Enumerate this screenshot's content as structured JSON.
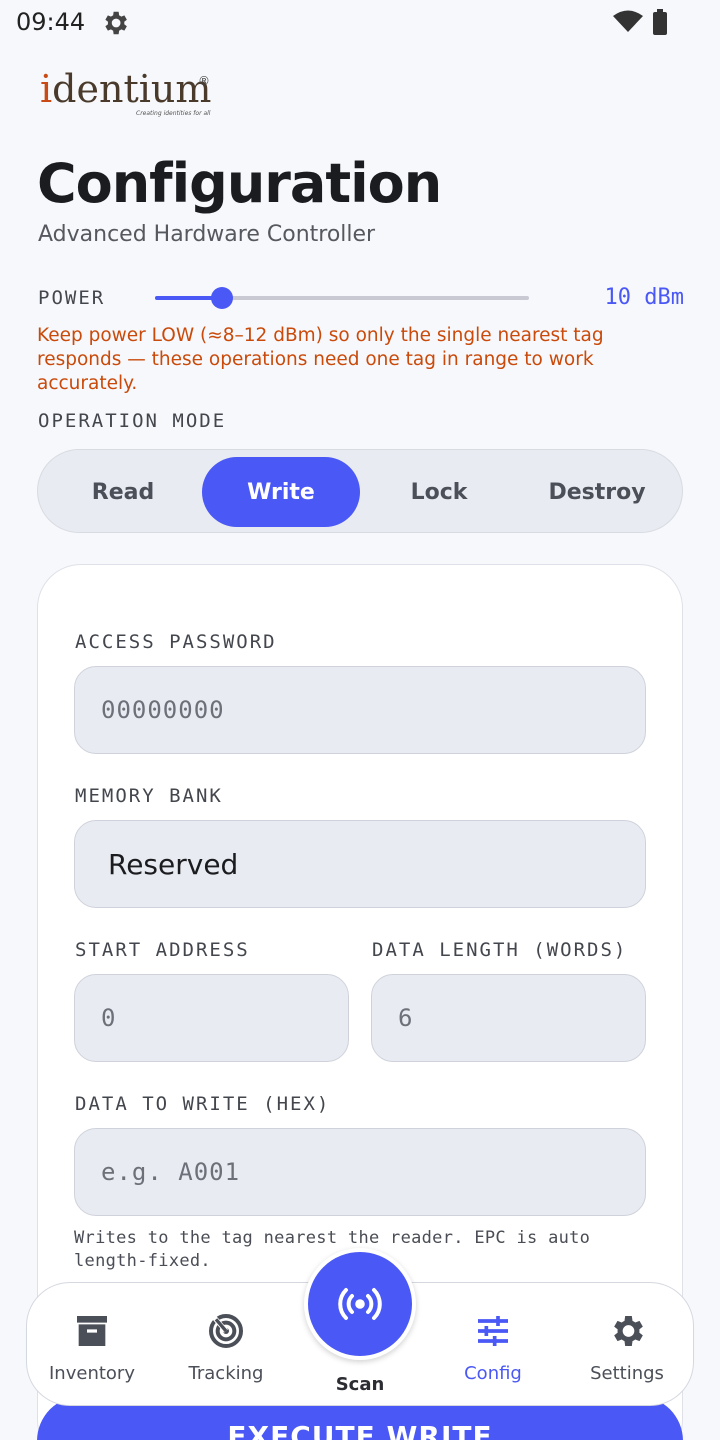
{
  "status_bar": {
    "time": "09:44"
  },
  "logo": {
    "text_i": "i",
    "text_rest": "dentium",
    "registered": "®",
    "tagline": "Creating identities for all"
  },
  "header": {
    "title": "Configuration",
    "subtitle": "Advanced Hardware Controller"
  },
  "power": {
    "label": "POWER",
    "value_text": "10 dBm",
    "level_fraction": 0.18
  },
  "warning": "Keep power LOW (≈8–12 dBm) so only the single nearest tag responds — these operations need one tag in range to work accurately.",
  "operation_mode": {
    "label": "OPERATION MODE",
    "options": [
      "Read",
      "Write",
      "Lock",
      "Destroy"
    ],
    "selected": "Write"
  },
  "form": {
    "access_password": {
      "label": "ACCESS PASSWORD",
      "value": "00000000"
    },
    "memory_bank": {
      "label": "MEMORY BANK",
      "value": "Reserved"
    },
    "start_address": {
      "label": "START ADDRESS",
      "value": "0"
    },
    "data_length": {
      "label": "DATA LENGTH (WORDS)",
      "value": "6"
    },
    "data_to_write": {
      "label": "DATA TO WRITE (HEX)",
      "placeholder": "e.g. A001"
    },
    "helper": "Writes to the tag nearest the reader. EPC is auto length-fixed."
  },
  "execute_button": "EXECUTE WRITE",
  "nav": {
    "items": [
      {
        "label": "Inventory",
        "icon": "archive-box-icon"
      },
      {
        "label": "Tracking",
        "icon": "radar-icon"
      },
      {
        "label": "Scan",
        "icon": "broadcast-icon"
      },
      {
        "label": "Config",
        "icon": "sliders-icon"
      },
      {
        "label": "Settings",
        "icon": "gear-icon"
      }
    ],
    "active": "Config"
  },
  "colors": {
    "accent": "#4a58f5",
    "warning": "#c94a0a",
    "brand_orange": "#c94a14"
  }
}
